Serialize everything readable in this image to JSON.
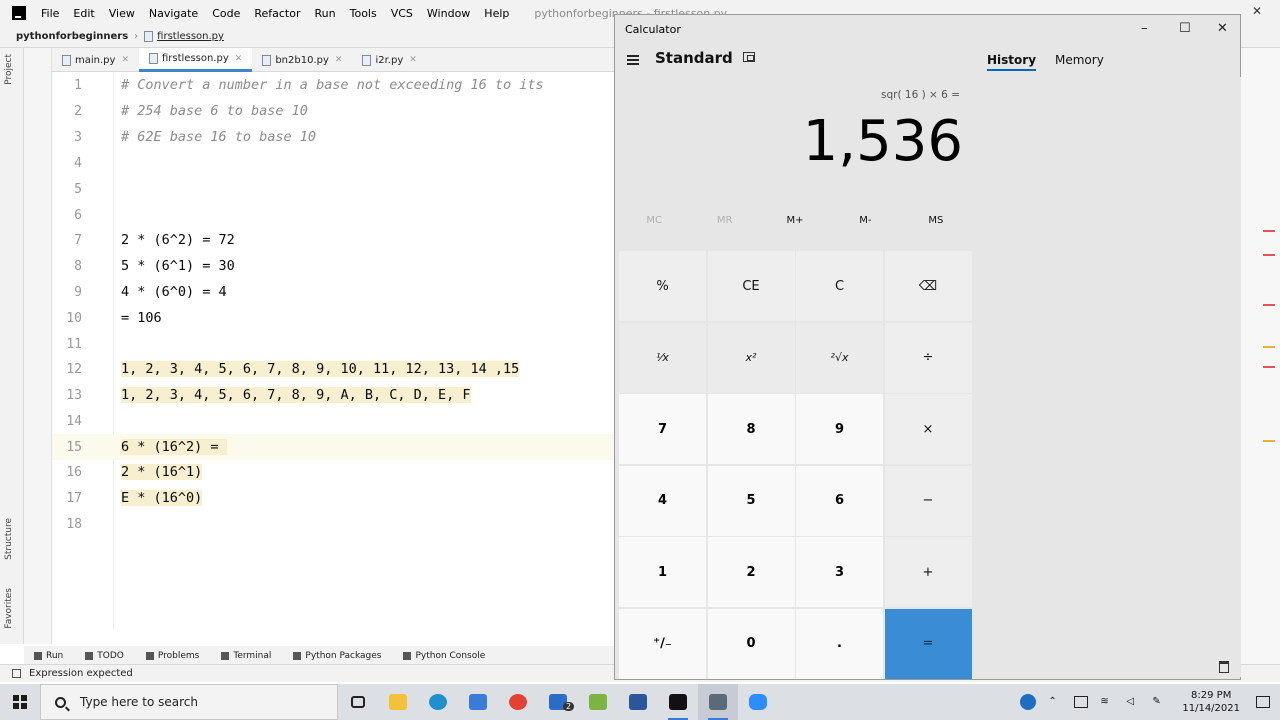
{
  "ide": {
    "menu": [
      "File",
      "Edit",
      "View",
      "Navigate",
      "Code",
      "Refactor",
      "Run",
      "Tools",
      "VCS",
      "Window",
      "Help"
    ],
    "title": "pythonforbeginners - firstlesson.py",
    "breadcrumb": {
      "project": "pythonforbeginners",
      "file": "firstlesson.py"
    },
    "tabs": [
      {
        "label": "main.py",
        "active": false
      },
      {
        "label": "firstlesson.py",
        "active": true
      },
      {
        "label": "bn2b10.py",
        "active": false
      },
      {
        "label": "i2r.py",
        "active": false
      }
    ],
    "side_tabs": {
      "project": "Project",
      "structure": "Structure",
      "favorites": "Favorites"
    },
    "lines": [
      {
        "n": "1",
        "text": "# Convert a number in a base not exceeding 16 to its"
      },
      {
        "n": "2",
        "text": "# 254 base 6 to base 10"
      },
      {
        "n": "3",
        "text": "# 62E base 16 to base 10"
      },
      {
        "n": "4",
        "text": ""
      },
      {
        "n": "5",
        "text": ""
      },
      {
        "n": "6",
        "text": ""
      },
      {
        "n": "7",
        "text": "2 * (6^2) = 72"
      },
      {
        "n": "8",
        "text": "5 * (6^1) = 30"
      },
      {
        "n": "9",
        "text": "4 * (6^0) = 4"
      },
      {
        "n": "10",
        "text": "= 106"
      },
      {
        "n": "11",
        "text": ""
      },
      {
        "n": "12",
        "text": "1, 2, 3, 4, 5, 6, 7, 8, 9, 10, 11, 12, 13, 14 ,15"
      },
      {
        "n": "13",
        "text": "1, 2, 3, 4, 5, 6, 7, 8, 9, A, B, C, D, E, F"
      },
      {
        "n": "14",
        "text": ""
      },
      {
        "n": "15",
        "text": "6 * (16^2) = "
      },
      {
        "n": "16",
        "text": "2 * (16^1)"
      },
      {
        "n": "17",
        "text": "E * (16^0)"
      },
      {
        "n": "18",
        "text": ""
      }
    ],
    "bottom_tools": [
      "Run",
      "TODO",
      "Problems",
      "Terminal",
      "Python Packages",
      "Python Console"
    ],
    "status": "Expression expected"
  },
  "calculator": {
    "window_title": "Calculator",
    "mode": "Standard",
    "panel_tabs": [
      "History",
      "Memory"
    ],
    "expression": "sqr( 16 ) × 6 =",
    "result": "1,536",
    "memory_buttons": [
      "MC",
      "MR",
      "M+",
      "M-",
      "MS"
    ],
    "keys": [
      "%",
      "CE",
      "C",
      "⌫",
      "¹⁄x",
      "x²",
      "²√x",
      "÷",
      "7",
      "8",
      "9",
      "×",
      "4",
      "5",
      "6",
      "−",
      "1",
      "2",
      "3",
      "+",
      "⁺∕₋",
      "0",
      ".",
      "="
    ]
  },
  "taskbar": {
    "search_placeholder": "Type here to search",
    "time": "8:29 PM",
    "date": "11/14/2021",
    "mail_badge": "2"
  },
  "colors": {
    "accent": "#0067c0",
    "equals_key": "#3a8dd4",
    "editor_highlight": "#f7efd0",
    "number_blue": "#1750eb"
  }
}
